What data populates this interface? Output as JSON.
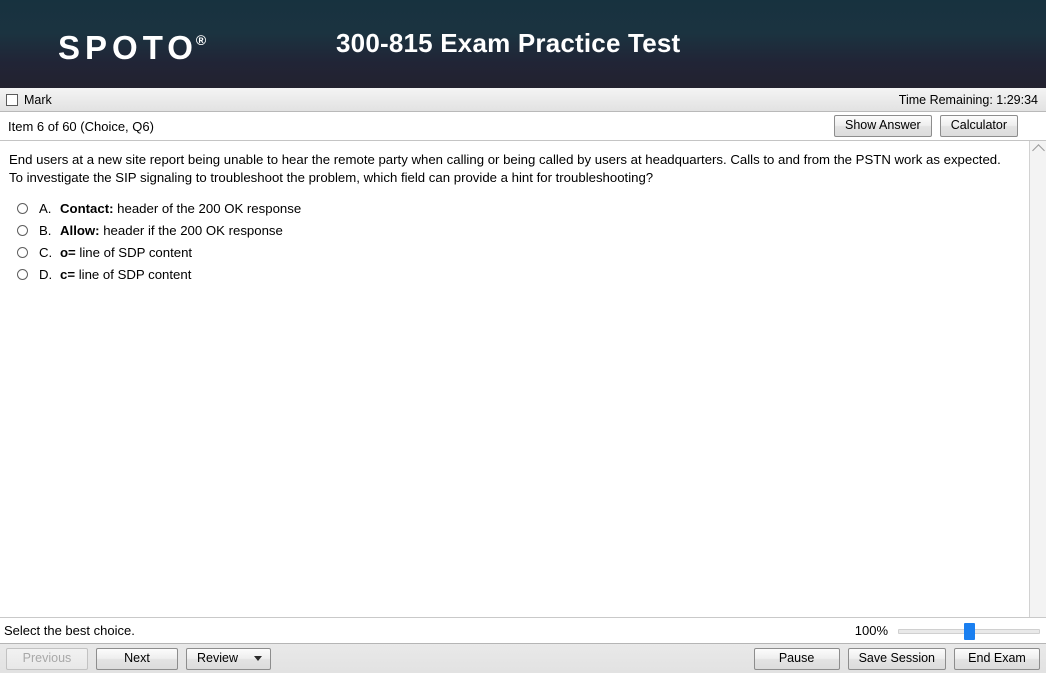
{
  "header": {
    "logo_text": "SPOTO",
    "logo_registered": "®",
    "exam_title": "300-815 Exam Practice Test"
  },
  "mark_bar": {
    "mark_label": "Mark",
    "timer_text": "Time Remaining: 1:29:34"
  },
  "item_bar": {
    "item_label": "Item 6 of 60  (Choice, Q6)",
    "show_answer_label": "Show Answer",
    "calculator_label": "Calculator"
  },
  "question": {
    "stem": "End users at a new site report being unable to hear the remote party when calling or being called by users at headquarters. Calls to and from the PSTN work as expected. To investigate the SIP signaling to troubleshoot the problem, which field can provide a hint for troubleshooting?",
    "options": [
      {
        "letter": "A.",
        "bold": "Contact:",
        "rest": " header of the 200 OK response",
        "selected": false
      },
      {
        "letter": "B.",
        "bold": "Allow:",
        "rest": " header if the 200 OK response",
        "selected": false
      },
      {
        "letter": "C.",
        "bold": "o=",
        "rest": " line of SDP content",
        "selected": false
      },
      {
        "letter": "D.",
        "bold": "c=",
        "rest": " line of SDP content",
        "selected": false
      }
    ]
  },
  "status_bar": {
    "instruction": "Select the best choice.",
    "zoom_percent": "100%"
  },
  "bottom_bar": {
    "previous_label": "Previous",
    "next_label": "Next",
    "review_label": "Review",
    "pause_label": "Pause",
    "save_session_label": "Save Session",
    "end_exam_label": "End Exam"
  },
  "colors": {
    "header_top": "#17323f",
    "header_bottom": "#23222f",
    "slider_thumb": "#1a7ff0"
  }
}
